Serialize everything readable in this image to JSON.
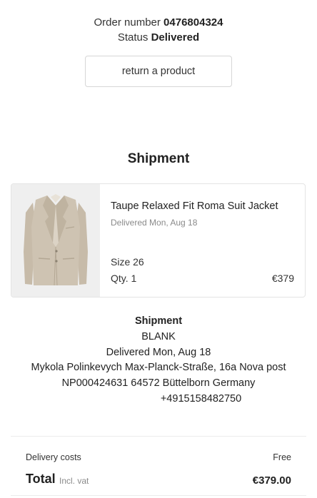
{
  "order": {
    "number_label": "Order number",
    "number": "0476804324",
    "status_label": "Status",
    "status": "Delivered",
    "return_button": "return a product"
  },
  "shipment_title": "Shipment",
  "item": {
    "name": "Taupe Relaxed Fit Roma Suit Jacket",
    "delivered": "Delivered Mon, Aug 18",
    "size": "Size 26",
    "qty": "Qty. 1",
    "price": "€379"
  },
  "shipment_info": {
    "heading": "Shipment",
    "carrier": "BLANK",
    "delivered": "Delivered Mon, Aug 18",
    "address_line1": "Mykola Polinkevych Max-Planck-Straße, 16a Nova post",
    "address_line2": "NP000424631 64572 Büttelborn Germany",
    "phone": "+4915158482750"
  },
  "summary": {
    "delivery_label": "Delivery costs",
    "delivery_value": "Free",
    "total_label": "Total",
    "total_sub": "Incl. vat",
    "total_value": "€379.00"
  },
  "colors": {
    "jacket": "#cbbfae",
    "thumb_bg": "#efefef",
    "border": "#d6d6d6"
  }
}
